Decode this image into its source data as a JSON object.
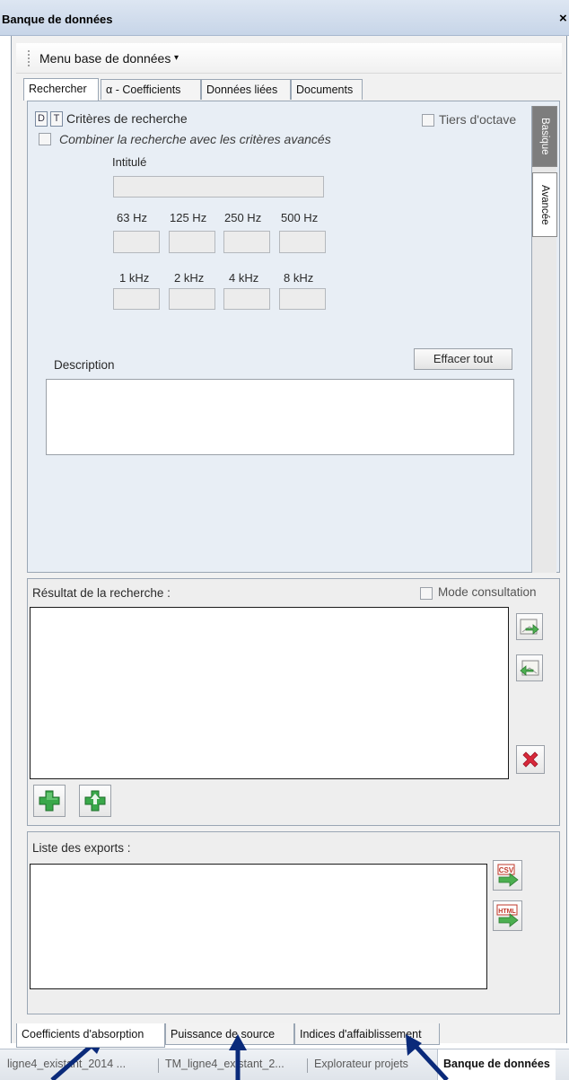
{
  "window": {
    "title": "Banque de données",
    "close_glyph": "×"
  },
  "menu": {
    "label": "Menu base de données",
    "caret": "▾"
  },
  "tabs": [
    {
      "label": "Rechercher",
      "active": true
    },
    {
      "label": "α - Coefficients",
      "active": false
    },
    {
      "label": "Données liées",
      "active": false
    },
    {
      "label": "Documents",
      "active": false
    }
  ],
  "side_tabs": {
    "basic": "Basique",
    "advanced": "Avancée"
  },
  "search": {
    "d_button": "D",
    "t_button": "T",
    "criteria_label": "Critères de recherche",
    "third_octave_label": "Tiers d'octave",
    "combine_label": "Combiner la recherche avec les critères avancés",
    "title_label": "Intitulé",
    "freq_row1": [
      "63 Hz",
      "125 Hz",
      "250 Hz",
      "500 Hz"
    ],
    "freq_row2": [
      "1 kHz",
      "2 kHz",
      "4 kHz",
      "8 kHz"
    ],
    "description_label": "Description",
    "clear_button": "Effacer tout"
  },
  "results": {
    "label": "Résultat de la recherche :",
    "consult_mode_label": "Mode consultation",
    "icons": [
      "export-right-icon",
      "import-left-icon",
      "delete-icon",
      "add-green-icon",
      "add-up-green-icon"
    ]
  },
  "exports": {
    "label": "Liste des exports :",
    "csv_badge": "CSV",
    "html_badge": "HTML"
  },
  "bottom_tabs": [
    {
      "label": "Coefficients d'absorption",
      "active": true
    },
    {
      "label": "Puissance de source",
      "active": false
    },
    {
      "label": "Indices d'affaiblissement",
      "active": false
    }
  ],
  "doc_tabs": [
    {
      "label": "ligne4_existant_2014 ...",
      "active": false
    },
    {
      "label": "TM_ligne4_existant_2...",
      "active": false
    },
    {
      "label": "Explorateur projets",
      "active": false
    },
    {
      "label": "Banque de données",
      "active": true
    }
  ],
  "colors": {
    "accent_blue": "#0a2a7a",
    "green": "#3aa84a",
    "red": "#d8283a"
  }
}
